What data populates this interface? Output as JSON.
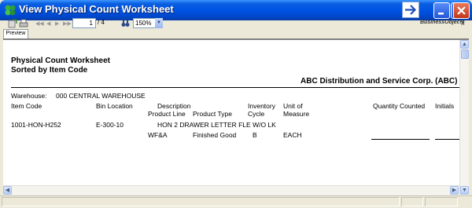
{
  "window": {
    "title": "View Physical Count Worksheet",
    "colors": {
      "titlebar": "#0054e3",
      "close": "#c2371a"
    }
  },
  "toolbar": {
    "page_current": "1",
    "page_total": "/ 4",
    "zoom": "150%",
    "logo_text": "BusinessObjects",
    "close_glyph": "x",
    "tab_label": "Preview"
  },
  "report": {
    "title_line1": "Physical Count Worksheet",
    "title_line2": "Sorted by Item Code",
    "company": "ABC Distribution and Service Corp. (ABC)",
    "warehouse_label": "Warehouse:",
    "warehouse_value": "000  CENTRAL WAREHOUSE",
    "columns": {
      "item_code": "Item Code",
      "bin_location": "Bin Location",
      "description": "Description",
      "product_line": "Product Line",
      "product_type": "Product Type",
      "inventory": "Inventory",
      "cycle": "Cycle",
      "unit_of": "Unit of",
      "measure": "Measure",
      "quantity_counted": "Quantity Counted",
      "initials": "Initials"
    },
    "rows": [
      {
        "item_code": "1001-HON-H252",
        "bin_location": "E-300-10",
        "description": "HON 2 DRAWER LETTER FLE W/O LK",
        "product_line": "WF&A",
        "product_type": "Finished Good",
        "cycle": "B",
        "unit": "EACH"
      }
    ]
  }
}
